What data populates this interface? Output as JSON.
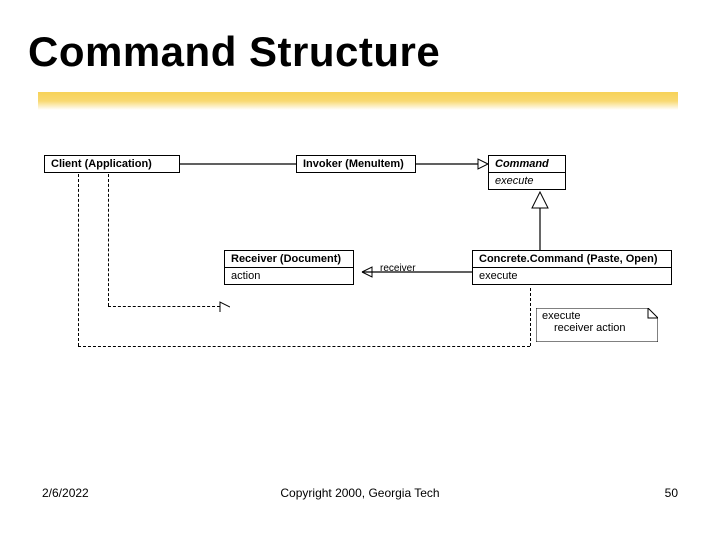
{
  "title": "Command Structure",
  "footer": {
    "date": "2/6/2022",
    "copyright": "Copyright 2000, Georgia Tech",
    "page": "50"
  },
  "boxes": {
    "client": {
      "name": "Client (Application)"
    },
    "invoker": {
      "name": "Invoker (MenuItem)"
    },
    "command": {
      "name": "Command",
      "op": "execute"
    },
    "receiver": {
      "name": "Receiver (Document)",
      "op": "action"
    },
    "concrete": {
      "name": "Concrete.Command (Paste, Open)",
      "op": "execute"
    }
  },
  "labels": {
    "receiver_assoc": "receiver"
  },
  "note": {
    "line1": "execute",
    "line2": "receiver action"
  }
}
